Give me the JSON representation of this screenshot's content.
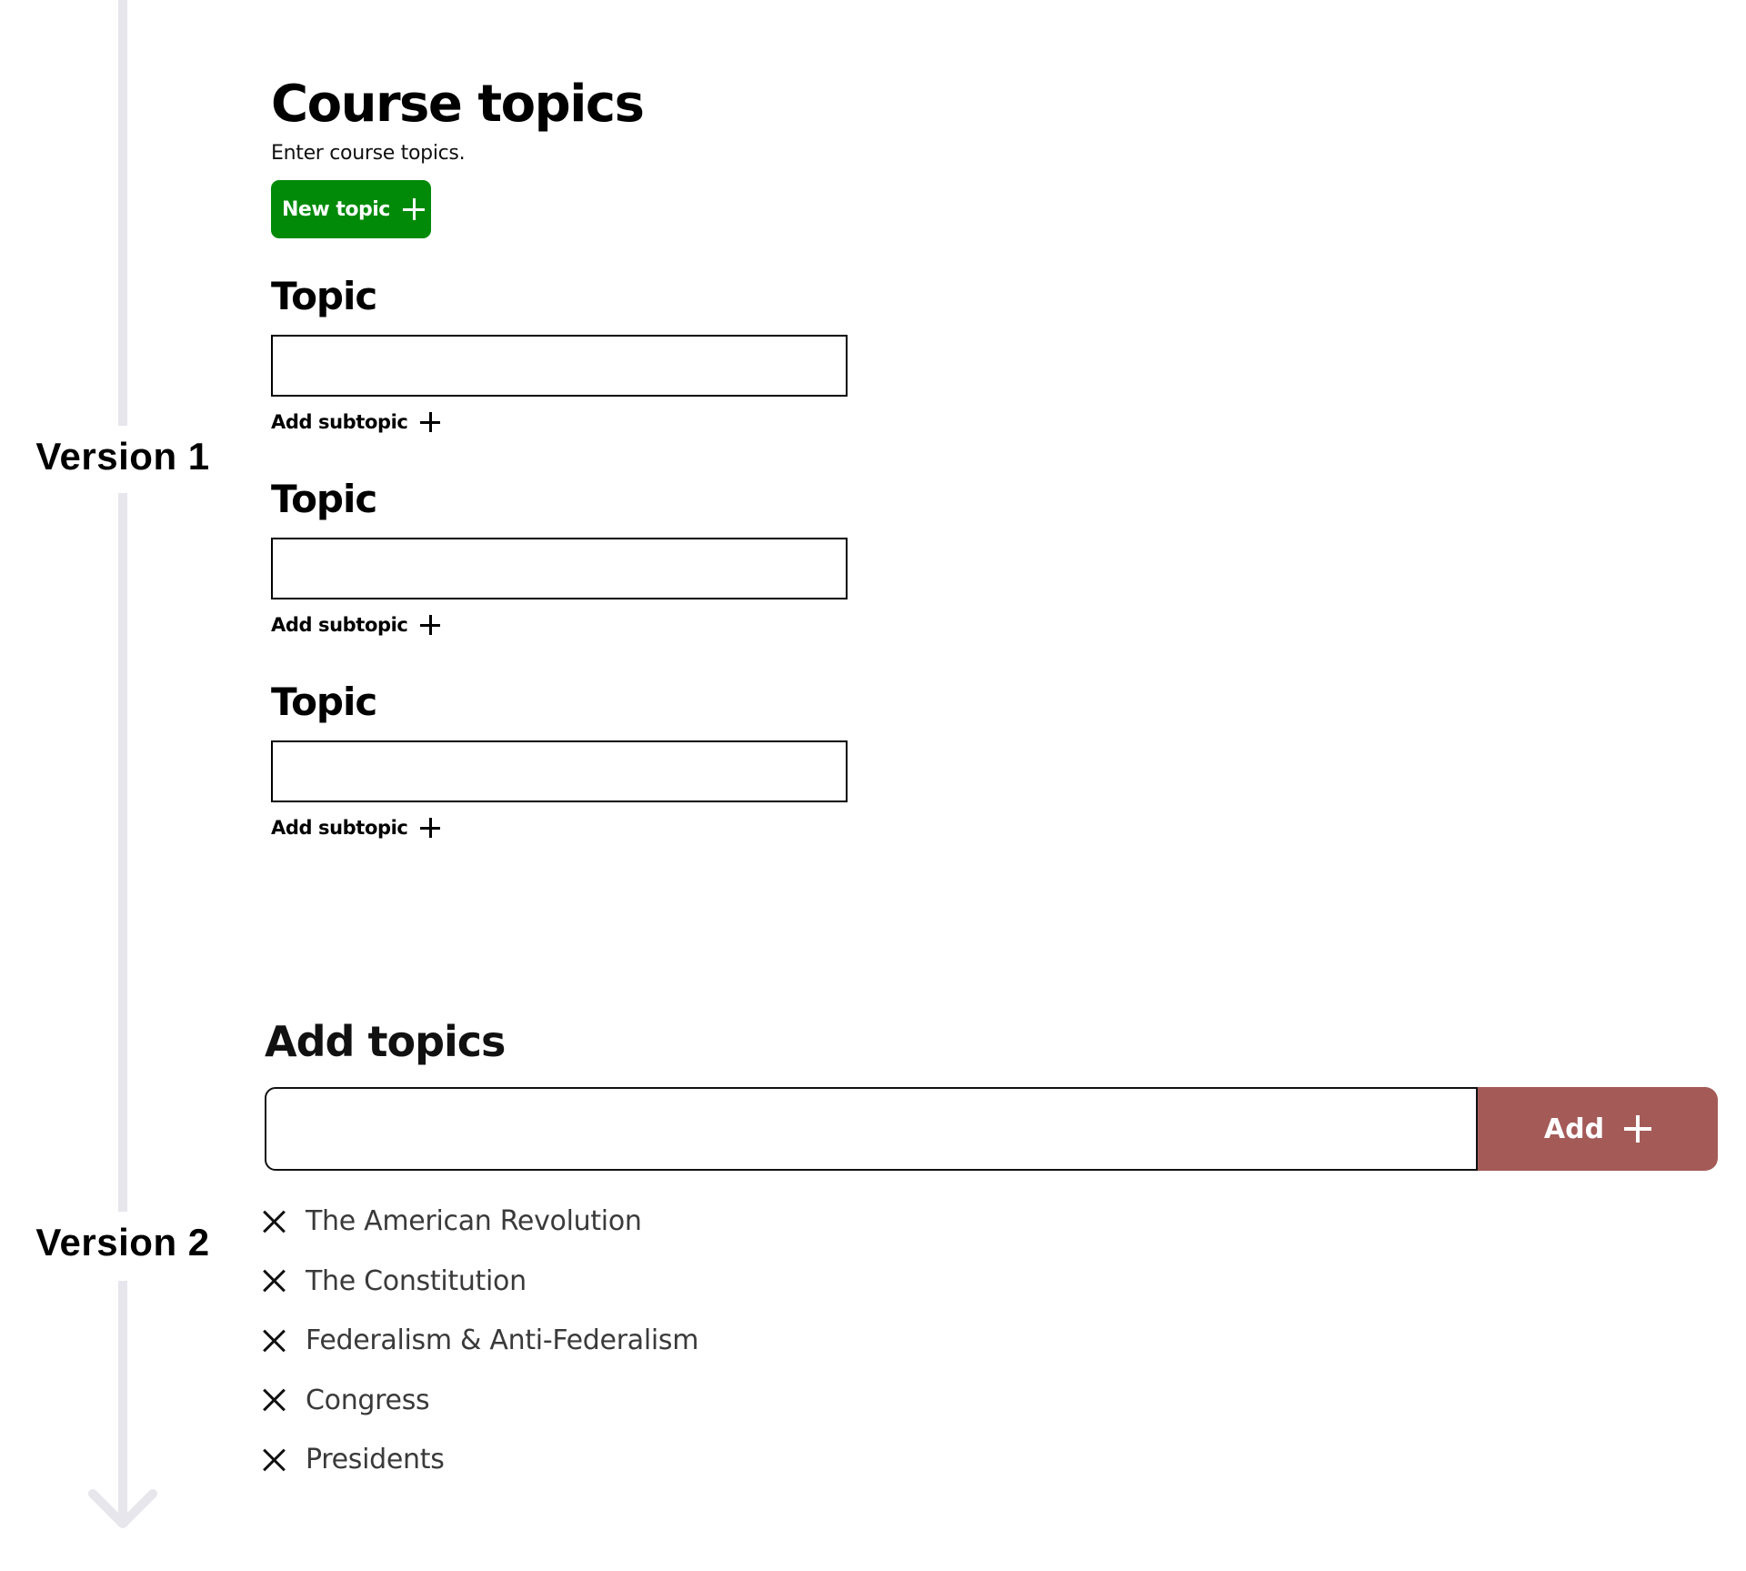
{
  "timeline": {
    "versions": [
      {
        "label": "Version 1"
      },
      {
        "label": "Version 2"
      }
    ],
    "line_color": "#e6e6ec",
    "end_icon": "arrow-down-icon"
  },
  "version1": {
    "title": "Course topics",
    "subtitle": "Enter course topics.",
    "new_topic_button": {
      "label": "New topic",
      "icon": "plus-icon",
      "color": "#008a08"
    },
    "topics": [
      {
        "label": "Topic",
        "value": "",
        "add_subtopic_label": "Add subtopic"
      },
      {
        "label": "Topic",
        "value": "",
        "add_subtopic_label": "Add subtopic"
      },
      {
        "label": "Topic",
        "value": "",
        "add_subtopic_label": "Add subtopic"
      }
    ]
  },
  "version2": {
    "title": "Add topics",
    "input": {
      "value": "",
      "placeholder": ""
    },
    "add_button": {
      "label": "Add",
      "icon": "plus-icon",
      "color": "#a45b58"
    },
    "topics": [
      {
        "label": "The American Revolution",
        "remove_icon": "close-icon"
      },
      {
        "label": "The Constitution",
        "remove_icon": "close-icon"
      },
      {
        "label": "Federalism & Anti-Federalism",
        "remove_icon": "close-icon"
      },
      {
        "label": "Congress",
        "remove_icon": "close-icon"
      },
      {
        "label": "Presidents",
        "remove_icon": "close-icon"
      }
    ]
  }
}
